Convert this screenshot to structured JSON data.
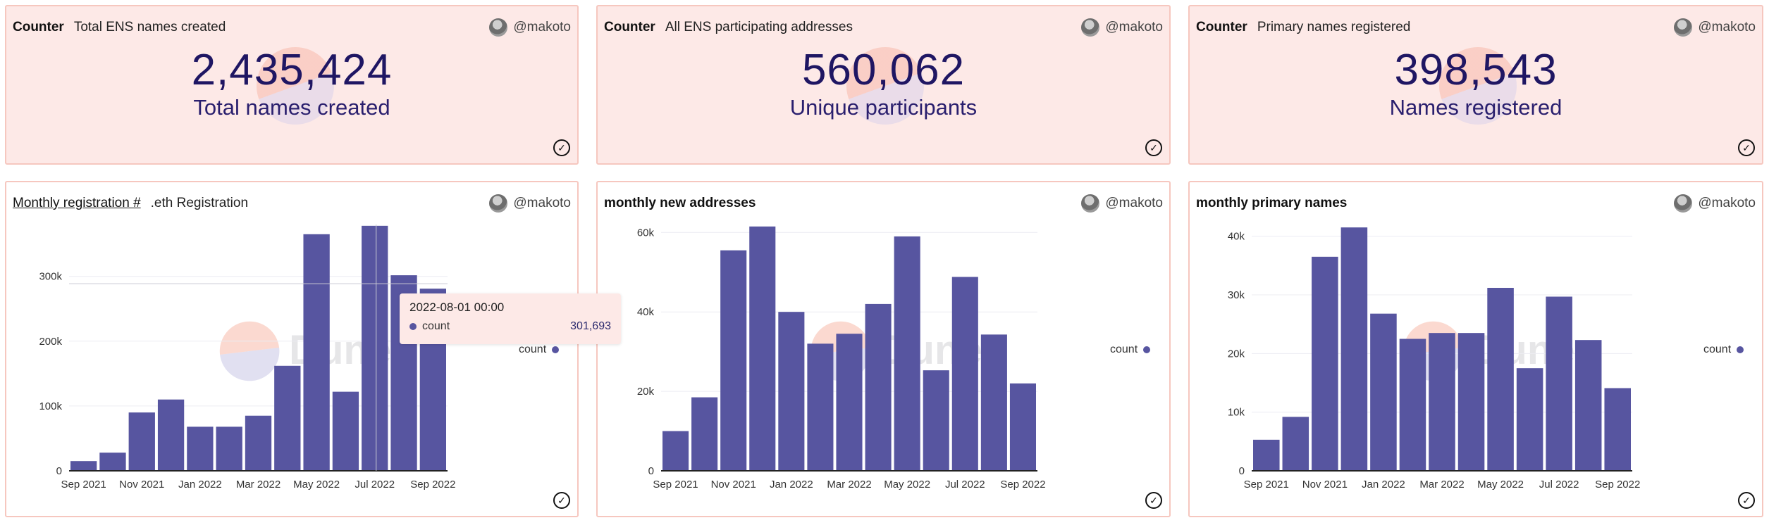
{
  "owner_handle": "@makoto",
  "counters": [
    {
      "query_name": "Counter",
      "subtitle": "Total ENS names created",
      "value": "2,435,424",
      "label": "Total names created"
    },
    {
      "query_name": "Counter",
      "subtitle": "All ENS participating addresses",
      "value": "560,062",
      "label": "Unique participants"
    },
    {
      "query_name": "Counter",
      "subtitle": "Primary names registered",
      "value": "398,543",
      "label": "Names registered"
    }
  ],
  "charts": [
    {
      "query_name": "Monthly registration #",
      "subtitle": ".eth Registration",
      "legend": "count"
    },
    {
      "query_name": "monthly new addresses",
      "subtitle": "",
      "legend": "count"
    },
    {
      "query_name": "monthly primary names",
      "subtitle": "",
      "legend": "count"
    }
  ],
  "watermark_text": "Dune",
  "tooltip": {
    "title": "2022-08-01 00:00",
    "series": "count",
    "value": "301,693"
  },
  "colors": {
    "bar": "#5755a0",
    "counter_bg": "#fde9e7",
    "border": "#f6c7bf",
    "value_text": "#1f1663"
  },
  "chart_data": [
    {
      "type": "bar",
      "categories": [
        "2021-09",
        "2021-10",
        "2021-11",
        "2021-12",
        "2022-01",
        "2022-02",
        "2022-03",
        "2022-04",
        "2022-05",
        "2022-06",
        "2022-07",
        "2022-08",
        "2022-09"
      ],
      "x_tick_labels": [
        "Sep 2021",
        "Nov 2021",
        "Jan 2022",
        "Mar 2022",
        "May 2022",
        "Jul 2022",
        "Sep 2022"
      ],
      "y_tick_labels": [
        "0",
        "100k",
        "200k",
        "300k"
      ],
      "ylim": [
        0,
        380000
      ],
      "series": [
        {
          "name": "count",
          "values": [
            15000,
            28000,
            90000,
            110000,
            68000,
            68000,
            85000,
            162000,
            365000,
            122000,
            378000,
            301693,
            281000
          ]
        }
      ],
      "grid": true,
      "legend": "right"
    },
    {
      "type": "bar",
      "categories": [
        "2021-09",
        "2021-10",
        "2021-11",
        "2021-12",
        "2022-01",
        "2022-02",
        "2022-03",
        "2022-04",
        "2022-05",
        "2022-06",
        "2022-07",
        "2022-08",
        "2022-09"
      ],
      "x_tick_labels": [
        "Sep 2021",
        "Nov 2021",
        "Jan 2022",
        "Mar 2022",
        "May 2022",
        "Jul 2022",
        "Sep 2022"
      ],
      "y_tick_labels": [
        "0",
        "20k",
        "40k",
        "60k"
      ],
      "ylim": [
        0,
        62000
      ],
      "series": [
        {
          "name": "count",
          "values": [
            10000,
            18500,
            55500,
            61500,
            40000,
            32000,
            34500,
            42000,
            59000,
            25300,
            48800,
            34300,
            22000
          ]
        }
      ],
      "grid": true,
      "legend": "right"
    },
    {
      "type": "bar",
      "categories": [
        "2021-09",
        "2021-10",
        "2021-11",
        "2021-12",
        "2022-01",
        "2022-02",
        "2022-03",
        "2022-04",
        "2022-05",
        "2022-06",
        "2022-07",
        "2022-08",
        "2022-09"
      ],
      "x_tick_labels": [
        "Sep 2021",
        "Nov 2021",
        "Jan 2022",
        "Mar 2022",
        "May 2022",
        "Jul 2022",
        "Sep 2022"
      ],
      "y_tick_labels": [
        "0",
        "10k",
        "20k",
        "30k",
        "40k"
      ],
      "ylim": [
        0,
        42000
      ],
      "series": [
        {
          "name": "count",
          "values": [
            5300,
            9200,
            36500,
            41500,
            26800,
            22500,
            23500,
            23500,
            31200,
            17500,
            29700,
            22300,
            14100
          ]
        }
      ],
      "grid": true,
      "legend": "right"
    }
  ]
}
